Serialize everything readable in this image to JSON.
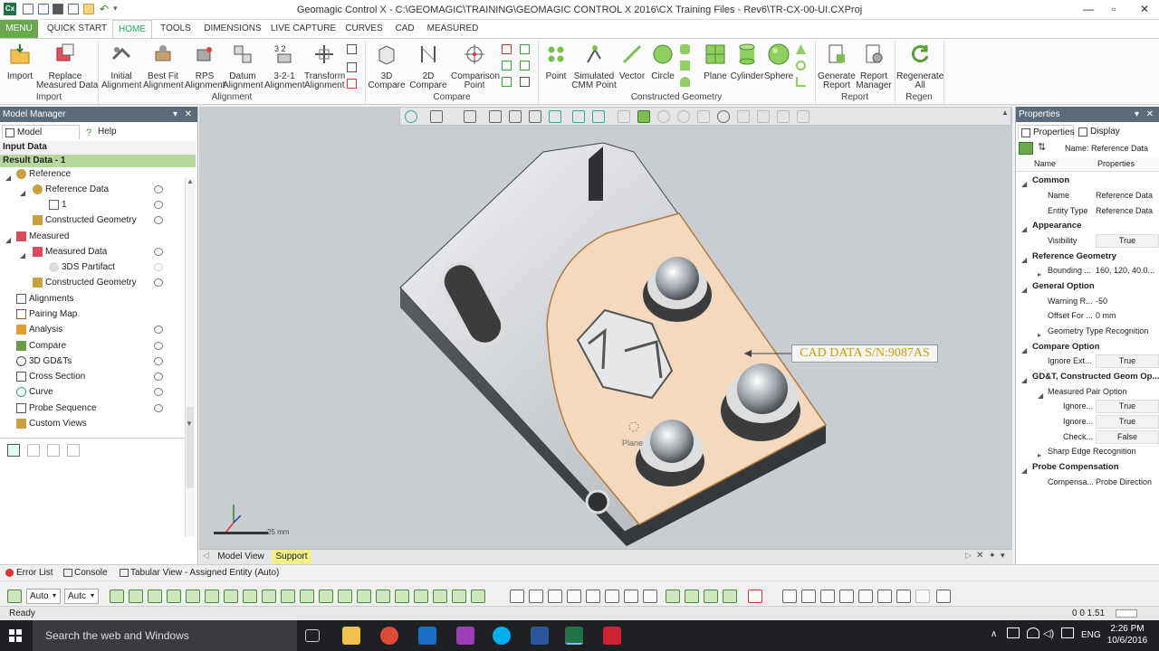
{
  "window": {
    "title": "Geomagic Control X - C:\\GEOMAGIC\\TRAINING\\GEOMAGIC CONTROL X 2016\\CX Training Files - Rev6\\TR-CX-00-UI.CXProj",
    "app_icon": "Cx"
  },
  "menu": {
    "menu_btn": "MENU",
    "tabs": [
      "QUICK START",
      "HOME",
      "TOOLS",
      "DIMENSIONS",
      "LIVE CAPTURE",
      "CURVES",
      "CAD",
      "MEASURED"
    ]
  },
  "ribbon": {
    "import": {
      "label": "Import",
      "replace1": "Replace",
      "replace2": "Measured Data",
      "group": "Import"
    },
    "alignment": {
      "initial1": "Initial",
      "initial2": "Alignment",
      "bestfit1": "Best Fit",
      "bestfit2": "Alignment",
      "rps1": "RPS",
      "rps2": "Alignment",
      "datum1": "Datum",
      "datum2": "Alignment",
      "three1": "3-2-1",
      "three2": "Alignment",
      "transform1": "Transform",
      "transform2": "Alignment",
      "group": "Alignment"
    },
    "compare": {
      "c3d1": "3D",
      "c3d2": "Compare",
      "c2d1": "2D",
      "c2d2": "Compare",
      "point1": "Comparison",
      "point2": "Point",
      "group": "Compare"
    },
    "construct": {
      "point": "Point",
      "sim1": "Simulated",
      "sim2": "CMM Point",
      "vector": "Vector",
      "circle": "Circle",
      "plane": "Plane",
      "cylinder": "Cylinder",
      "sphere": "Sphere",
      "group": "Constructed Geometry"
    },
    "report": {
      "gen1": "Generate",
      "gen2": "Report",
      "rm1": "Report",
      "rm2": "Manager",
      "group": "Report"
    },
    "regen": {
      "r1": "Regenerate",
      "r2": "All",
      "group": "Regen"
    }
  },
  "model_manager": {
    "title": "Model Manager",
    "tab_model": "Model Manager",
    "tab_help": "Help",
    "input_data": "Input Data",
    "result_data": "Result Data - 1",
    "tree": [
      "Reference",
      "Reference Data",
      "1",
      "Constructed Geometry",
      "Measured",
      "Measured Data",
      "3DS Partifact",
      "Constructed Geometry",
      "Alignments",
      "Pairing Map",
      "Analysis",
      "Compare",
      "3D GD&Ts",
      "Cross Section",
      "Curve",
      "Probe Sequence",
      "Custom Views"
    ]
  },
  "viewport": {
    "annotation": "CAD DATA S/N:9087AS",
    "scale": "25 mm",
    "plane_hint": "Plane",
    "tab_model": "Model View",
    "tab_support": "Support"
  },
  "properties": {
    "title": "Properties",
    "tab_props": "Properties",
    "tab_display": "Display",
    "name_line": "Name: Reference Data",
    "col_name": "Name",
    "col_props": "Properties",
    "rows": [
      {
        "n": "Common",
        "v": ""
      },
      {
        "n": "Name",
        "v": "Reference Data"
      },
      {
        "n": "Entity Type",
        "v": "Reference Data"
      },
      {
        "n": "Appearance",
        "v": ""
      },
      {
        "n": "Visibility",
        "v": "True"
      },
      {
        "n": "Reference Geometry",
        "v": ""
      },
      {
        "n": "Bounding ...",
        "v": "160, 120, 40.0..."
      },
      {
        "n": "General Option",
        "v": ""
      },
      {
        "n": "Warning R...",
        "v": "-50"
      },
      {
        "n": "Offset For ...",
        "v": "0 mm"
      },
      {
        "n": "Geometry Type Recognition",
        "v": ""
      },
      {
        "n": "Compare Option",
        "v": ""
      },
      {
        "n": "Ignore Ext...",
        "v": "True"
      },
      {
        "n": "GD&T, Constructed Geom Op...",
        "v": ""
      },
      {
        "n": "Measured Pair Option",
        "v": ""
      },
      {
        "n": "Ignore...",
        "v": "True"
      },
      {
        "n": "Ignore...",
        "v": "True"
      },
      {
        "n": "Check...",
        "v": "False"
      },
      {
        "n": "Sharp Edge Recognition",
        "v": ""
      },
      {
        "n": "Probe Compensation",
        "v": ""
      },
      {
        "n": "Compensa...",
        "v": "Probe Direction"
      }
    ]
  },
  "bottom": {
    "error_list": "Error List",
    "console": "Console",
    "tabular": "Tabular View - Assigned Entity (Auto)",
    "sel1": "Auto",
    "sel2": "Autc"
  },
  "status": {
    "text": "Ready",
    "coords": "0 0 1.51"
  },
  "taskbar": {
    "search": "Search the web and Windows",
    "lang": "ENG",
    "time": "2:26 PM",
    "date": "10/6/2016"
  },
  "colors": {
    "accent_green": "#6aa84f",
    "result_bar": "#b5d99c",
    "support_tab": "#f6f08a",
    "annotation_text": "#c8a000",
    "part_face": "#f4d9bf"
  }
}
